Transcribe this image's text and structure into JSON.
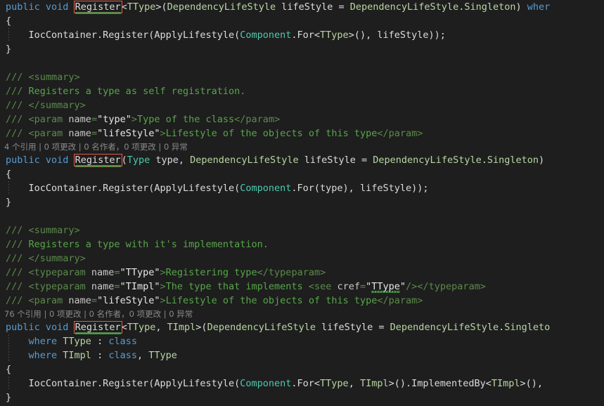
{
  "editor": {
    "language": "csharp",
    "theme": "dark",
    "background": "#1e1e1e",
    "colors": {
      "keyword": "#569cd6",
      "plain": "#dcdcdc",
      "type": "#4ec9b0",
      "generic_type": "#b8d7a3",
      "comment": "#57a64a",
      "codelens": "#8a8a8a",
      "rename_box_border": "#e05b4b",
      "squiggle": "#4caf50"
    }
  },
  "lines": [
    {
      "id": "l1",
      "kind": "code",
      "tokens": [
        {
          "t": "public",
          "c": "kw"
        },
        {
          "t": " ",
          "c": "plain"
        },
        {
          "t": "void",
          "c": "kw"
        },
        {
          "t": " ",
          "c": "plain"
        },
        {
          "t": "Register",
          "c": "renamebox"
        },
        {
          "t": "<",
          "c": "plain"
        },
        {
          "t": "TType",
          "c": "gtype"
        },
        {
          "t": ">(",
          "c": "plain"
        },
        {
          "t": "DependencyLifeStyle",
          "c": "gtype"
        },
        {
          "t": " lifeStyle = ",
          "c": "plain"
        },
        {
          "t": "DependencyLifeStyle",
          "c": "gtype"
        },
        {
          "t": ".",
          "c": "plain"
        },
        {
          "t": "Singleton",
          "c": "gtype"
        },
        {
          "t": ") ",
          "c": "plain"
        },
        {
          "t": "wher",
          "c": "kw"
        }
      ]
    },
    {
      "id": "l2",
      "kind": "code",
      "tokens": [
        {
          "t": "{",
          "c": "plain"
        }
      ]
    },
    {
      "id": "l3",
      "kind": "code",
      "guide": true,
      "tokens": [
        {
          "t": "    IocContainer.Register(ApplyLifestyle(",
          "c": "plain"
        },
        {
          "t": "Component",
          "c": "type"
        },
        {
          "t": ".For<",
          "c": "plain"
        },
        {
          "t": "TType",
          "c": "gtype"
        },
        {
          "t": ">(), lifeStyle));",
          "c": "plain"
        }
      ]
    },
    {
      "id": "l4",
      "kind": "code",
      "tokens": [
        {
          "t": "}",
          "c": "plain"
        }
      ]
    },
    {
      "id": "l5",
      "kind": "blank",
      "tokens": []
    },
    {
      "id": "l6",
      "kind": "code",
      "tokens": [
        {
          "t": "/// ",
          "c": "cmttag"
        },
        {
          "t": "<summary>",
          "c": "cmttag"
        }
      ]
    },
    {
      "id": "l7",
      "kind": "code",
      "tokens": [
        {
          "t": "/// ",
          "c": "cmttag"
        },
        {
          "t": "Registers a type as self registration.",
          "c": "cmt"
        }
      ]
    },
    {
      "id": "l8",
      "kind": "code",
      "tokens": [
        {
          "t": "/// ",
          "c": "cmttag"
        },
        {
          "t": "</summary>",
          "c": "cmttag"
        }
      ]
    },
    {
      "id": "l9",
      "kind": "code",
      "tokens": [
        {
          "t": "/// ",
          "c": "cmttag"
        },
        {
          "t": "<param ",
          "c": "cmttag"
        },
        {
          "t": "name",
          "c": "cmtname"
        },
        {
          "t": "=",
          "c": "cmttag"
        },
        {
          "t": "\"type\"",
          "c": "cmtval"
        },
        {
          "t": ">",
          "c": "cmttag"
        },
        {
          "t": "Type of the class",
          "c": "cmt"
        },
        {
          "t": "</param>",
          "c": "cmttag"
        }
      ]
    },
    {
      "id": "l10",
      "kind": "code",
      "tokens": [
        {
          "t": "/// ",
          "c": "cmttag"
        },
        {
          "t": "<param ",
          "c": "cmttag"
        },
        {
          "t": "name",
          "c": "cmtname"
        },
        {
          "t": "=",
          "c": "cmttag"
        },
        {
          "t": "\"lifeStyle\"",
          "c": "cmtval"
        },
        {
          "t": ">",
          "c": "cmttag"
        },
        {
          "t": "Lifestyle of the objects of this type",
          "c": "cmt"
        },
        {
          "t": "</param>",
          "c": "cmttag"
        }
      ]
    },
    {
      "id": "l11",
      "kind": "codelens",
      "text": "4 个引用 | 0 项更改 | 0 名作者，0 项更改 | 0 异常"
    },
    {
      "id": "l12",
      "kind": "code",
      "tokens": [
        {
          "t": "public",
          "c": "kw"
        },
        {
          "t": " ",
          "c": "plain"
        },
        {
          "t": "void",
          "c": "kw"
        },
        {
          "t": " ",
          "c": "plain"
        },
        {
          "t": "Register",
          "c": "renamebox"
        },
        {
          "t": "(",
          "c": "plain"
        },
        {
          "t": "Type",
          "c": "type"
        },
        {
          "t": " type, ",
          "c": "plain"
        },
        {
          "t": "DependencyLifeStyle",
          "c": "gtype"
        },
        {
          "t": " lifeStyle = ",
          "c": "plain"
        },
        {
          "t": "DependencyLifeStyle",
          "c": "gtype"
        },
        {
          "t": ".",
          "c": "plain"
        },
        {
          "t": "Singleton",
          "c": "gtype"
        },
        {
          "t": ")",
          "c": "plain"
        }
      ]
    },
    {
      "id": "l13",
      "kind": "code",
      "tokens": [
        {
          "t": "{",
          "c": "plain"
        }
      ]
    },
    {
      "id": "l14",
      "kind": "code",
      "guide": true,
      "tokens": [
        {
          "t": "    IocContainer.Register(ApplyLifestyle(",
          "c": "plain"
        },
        {
          "t": "Component",
          "c": "type"
        },
        {
          "t": ".For(type), lifeStyle));",
          "c": "plain"
        }
      ]
    },
    {
      "id": "l15",
      "kind": "code",
      "tokens": [
        {
          "t": "}",
          "c": "plain"
        }
      ]
    },
    {
      "id": "l16",
      "kind": "blank",
      "tokens": []
    },
    {
      "id": "l17",
      "kind": "code",
      "tokens": [
        {
          "t": "/// ",
          "c": "cmttag"
        },
        {
          "t": "<summary>",
          "c": "cmttag"
        }
      ]
    },
    {
      "id": "l18",
      "kind": "code",
      "tokens": [
        {
          "t": "/// ",
          "c": "cmttag"
        },
        {
          "t": "Registers a type with it's implementation.",
          "c": "cmt"
        }
      ]
    },
    {
      "id": "l19",
      "kind": "code",
      "tokens": [
        {
          "t": "/// ",
          "c": "cmttag"
        },
        {
          "t": "</summary>",
          "c": "cmttag"
        }
      ]
    },
    {
      "id": "l20",
      "kind": "code",
      "tokens": [
        {
          "t": "/// ",
          "c": "cmttag"
        },
        {
          "t": "<typeparam ",
          "c": "cmttag"
        },
        {
          "t": "name",
          "c": "cmtname"
        },
        {
          "t": "=",
          "c": "cmttag"
        },
        {
          "t": "\"TType\"",
          "c": "cmtval"
        },
        {
          "t": ">",
          "c": "cmttag"
        },
        {
          "t": "Registering type",
          "c": "cmt"
        },
        {
          "t": "</typeparam>",
          "c": "cmttag"
        }
      ]
    },
    {
      "id": "l21",
      "kind": "code",
      "tokens": [
        {
          "t": "/// ",
          "c": "cmttag"
        },
        {
          "t": "<typeparam ",
          "c": "cmttag"
        },
        {
          "t": "name",
          "c": "cmtname"
        },
        {
          "t": "=",
          "c": "cmttag"
        },
        {
          "t": "\"TImpl\"",
          "c": "cmtval"
        },
        {
          "t": ">",
          "c": "cmttag"
        },
        {
          "t": "The type that implements ",
          "c": "cmt"
        },
        {
          "t": "<see ",
          "c": "cmttag"
        },
        {
          "t": "cref",
          "c": "cmtname"
        },
        {
          "t": "=",
          "c": "cmttag"
        },
        {
          "t": "\"",
          "c": "cmtval"
        },
        {
          "t": "TType",
          "c": "cmtval-sq"
        },
        {
          "t": "\"",
          "c": "cmtval"
        },
        {
          "t": "/>",
          "c": "cmttag"
        },
        {
          "t": "</typeparam>",
          "c": "cmttag"
        }
      ]
    },
    {
      "id": "l22",
      "kind": "code",
      "tokens": [
        {
          "t": "/// ",
          "c": "cmttag"
        },
        {
          "t": "<param ",
          "c": "cmttag"
        },
        {
          "t": "name",
          "c": "cmtname"
        },
        {
          "t": "=",
          "c": "cmttag"
        },
        {
          "t": "\"lifeStyle\"",
          "c": "cmtval"
        },
        {
          "t": ">",
          "c": "cmttag"
        },
        {
          "t": "Lifestyle of the objects of this type",
          "c": "cmt"
        },
        {
          "t": "</param>",
          "c": "cmttag"
        }
      ]
    },
    {
      "id": "l23",
      "kind": "codelens",
      "text": "76 个引用 | 0 项更改 | 0 名作者，0 项更改 | 0 异常"
    },
    {
      "id": "l24",
      "kind": "code",
      "tokens": [
        {
          "t": "public",
          "c": "kw"
        },
        {
          "t": " ",
          "c": "plain"
        },
        {
          "t": "void",
          "c": "kw"
        },
        {
          "t": " ",
          "c": "plain"
        },
        {
          "t": "Register",
          "c": "renamebox"
        },
        {
          "t": "<",
          "c": "plain"
        },
        {
          "t": "TType",
          "c": "gtype"
        },
        {
          "t": ", ",
          "c": "plain"
        },
        {
          "t": "TImpl",
          "c": "gtype"
        },
        {
          "t": ">(",
          "c": "plain"
        },
        {
          "t": "DependencyLifeStyle",
          "c": "gtype"
        },
        {
          "t": " lifeStyle = ",
          "c": "plain"
        },
        {
          "t": "DependencyLifeStyle",
          "c": "gtype"
        },
        {
          "t": ".",
          "c": "plain"
        },
        {
          "t": "Singleto",
          "c": "gtype"
        }
      ]
    },
    {
      "id": "l25",
      "kind": "code",
      "guide": true,
      "tokens": [
        {
          "t": "    ",
          "c": "plain"
        },
        {
          "t": "where",
          "c": "kw"
        },
        {
          "t": " ",
          "c": "plain"
        },
        {
          "t": "TType",
          "c": "gtype"
        },
        {
          "t": " : ",
          "c": "plain"
        },
        {
          "t": "class",
          "c": "kw"
        }
      ]
    },
    {
      "id": "l26",
      "kind": "code",
      "guide": true,
      "tokens": [
        {
          "t": "    ",
          "c": "plain"
        },
        {
          "t": "where",
          "c": "kw"
        },
        {
          "t": " ",
          "c": "plain"
        },
        {
          "t": "TImpl",
          "c": "gtype"
        },
        {
          "t": " : ",
          "c": "plain"
        },
        {
          "t": "class",
          "c": "kw"
        },
        {
          "t": ", ",
          "c": "plain"
        },
        {
          "t": "TType",
          "c": "gtype"
        }
      ]
    },
    {
      "id": "l27",
      "kind": "code",
      "tokens": [
        {
          "t": "{",
          "c": "plain"
        }
      ]
    },
    {
      "id": "l28",
      "kind": "code",
      "guide": true,
      "tokens": [
        {
          "t": "    IocContainer.Register(ApplyLifestyle(",
          "c": "plain"
        },
        {
          "t": "Component",
          "c": "type"
        },
        {
          "t": ".For<",
          "c": "plain"
        },
        {
          "t": "TType",
          "c": "gtype"
        },
        {
          "t": ", ",
          "c": "plain"
        },
        {
          "t": "TImpl",
          "c": "gtype"
        },
        {
          "t": ">().ImplementedBy<",
          "c": "plain"
        },
        {
          "t": "TImpl",
          "c": "gtype"
        },
        {
          "t": ">(),",
          "c": "plain"
        }
      ]
    },
    {
      "id": "l29",
      "kind": "code",
      "tokens": [
        {
          "t": "}",
          "c": "plain"
        }
      ]
    }
  ]
}
